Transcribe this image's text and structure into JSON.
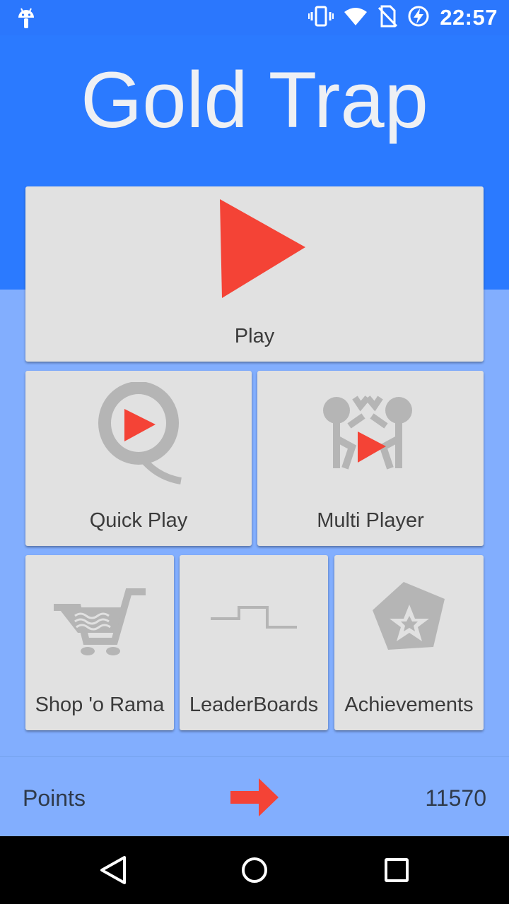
{
  "status_bar": {
    "time": "22:57",
    "icons": [
      "android-debug-icon",
      "vibrate-icon",
      "wifi-icon",
      "no-sim-icon",
      "battery-charging-icon"
    ]
  },
  "header": {
    "title": "Gold Trap"
  },
  "menu": {
    "play": {
      "label": "Play",
      "icon": "play-triangle-icon"
    },
    "quick_play": {
      "label": "Quick Play",
      "icon": "quick-play-icon"
    },
    "multi_player": {
      "label": "Multi Player",
      "icon": "multi-player-icon"
    },
    "shop": {
      "label": "Shop 'o Rama",
      "icon": "shopping-cart-icon"
    },
    "leaderboards": {
      "label": "LeaderBoards",
      "icon": "leaderboard-steps-icon"
    },
    "achievements": {
      "label": "Achievements",
      "icon": "star-pentagon-icon"
    }
  },
  "points": {
    "label": "Points",
    "value": "11570",
    "icon": "arrow-right-icon"
  },
  "nav": {
    "back": "back-icon",
    "home": "home-icon",
    "recents": "recents-icon"
  },
  "colors": {
    "header_blue": "#2b7aff",
    "background_blue": "#82aefe",
    "tile_gray": "#e1e1e1",
    "accent_red": "#f44336",
    "icon_gray": "#b5b5b5"
  }
}
